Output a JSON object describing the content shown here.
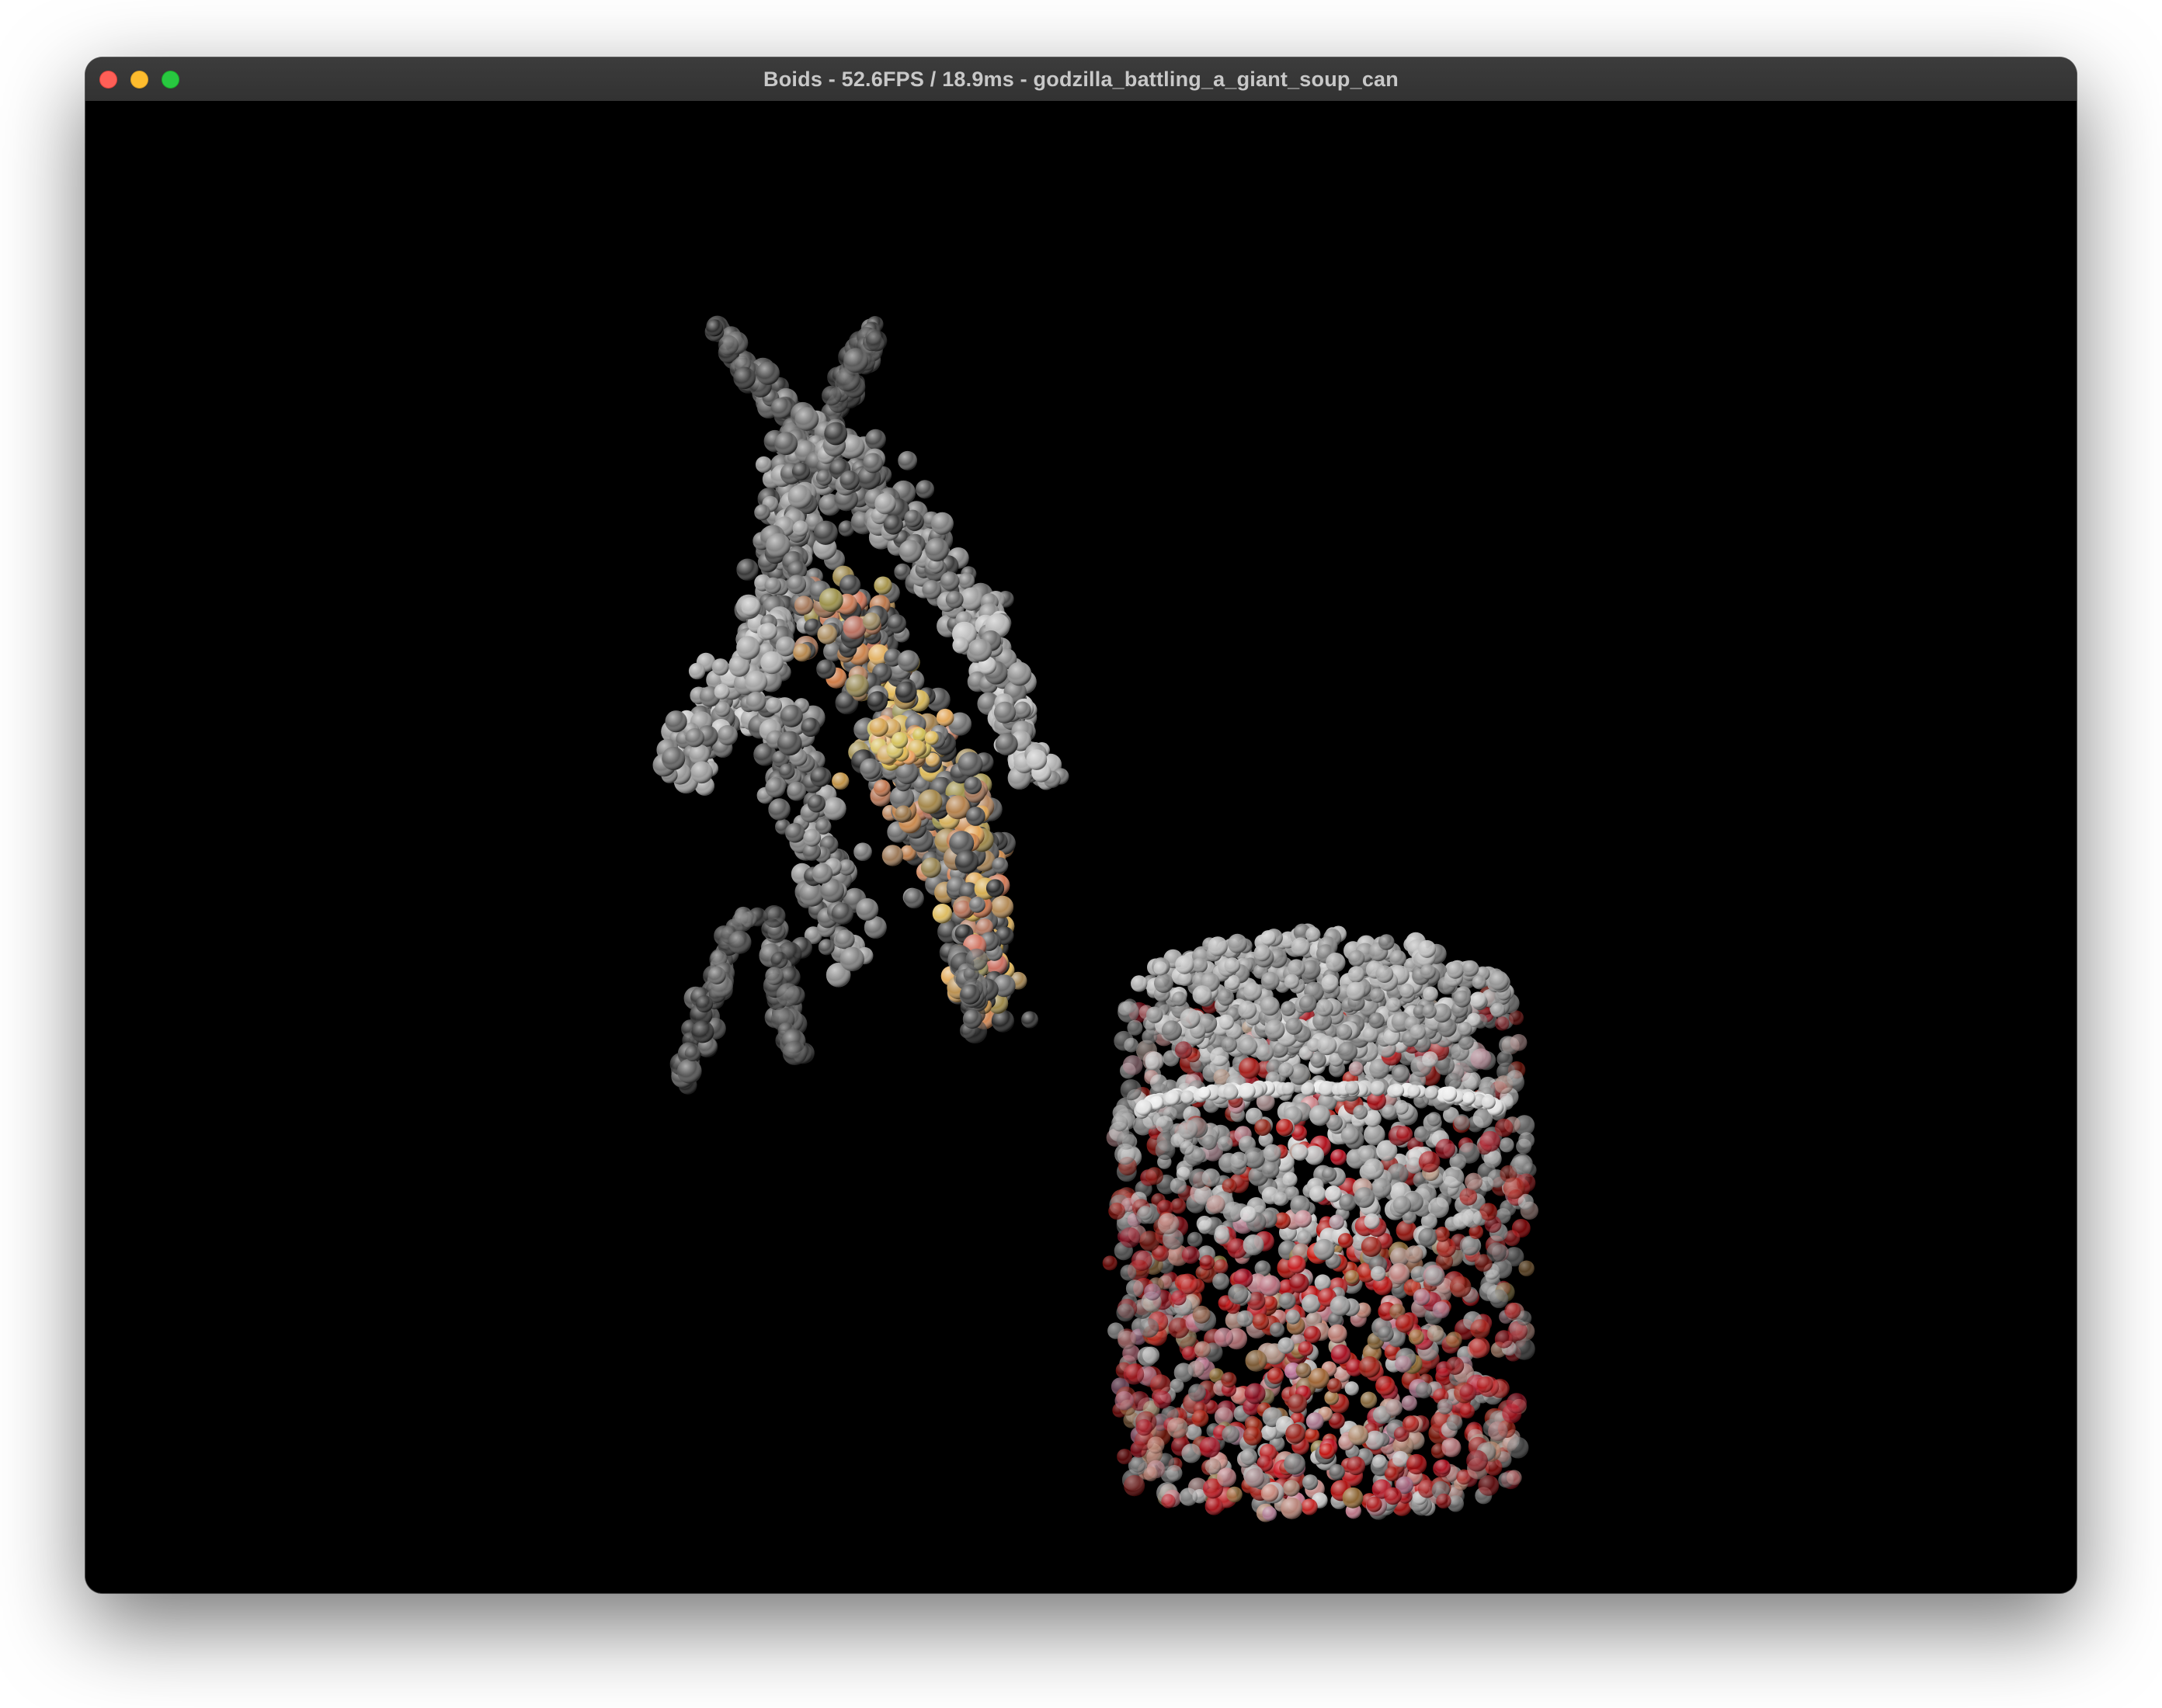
{
  "window": {
    "title": "Boids - 52.6FPS / 18.9ms - godzilla_battling_a_giant_soup_can",
    "traffic_lights": [
      {
        "name": "close",
        "color": "#fe5f57"
      },
      {
        "name": "minimize",
        "color": "#febc2e"
      },
      {
        "name": "zoom",
        "color": "#28c840"
      }
    ]
  },
  "scene": {
    "background": "#000000",
    "objects": [
      {
        "name": "godzilla-figure",
        "palette": [
          "#8a8a8a",
          "#5e5e5e",
          "#3a3a3a",
          "#b08a64",
          "#d4a458"
        ]
      },
      {
        "name": "soup-can",
        "palette": [
          "#9a9a9a",
          "#c8c8c8",
          "#8b1a1a",
          "#b02020",
          "#b89090",
          "#6a4a30"
        ]
      }
    ]
  }
}
